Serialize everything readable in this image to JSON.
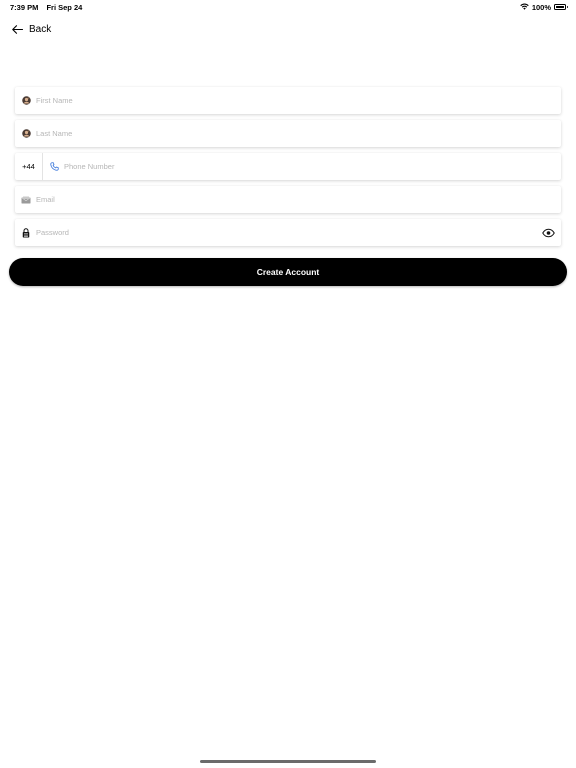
{
  "status_bar": {
    "time": "7:39 PM",
    "date": "Fri Sep 24",
    "battery": "100%",
    "battery_level": 1.0
  },
  "nav": {
    "back_label": "Back"
  },
  "form": {
    "first_name": {
      "placeholder": "First Name",
      "value": "",
      "icon": "user-avatar-icon"
    },
    "last_name": {
      "placeholder": "Last Name",
      "value": "",
      "icon": "user-avatar-icon"
    },
    "phone": {
      "country_code": "+44",
      "placeholder": "Phone Number",
      "value": "",
      "icon": "phone-icon"
    },
    "email": {
      "placeholder": "Email",
      "value": "",
      "icon": "envelope-icon"
    },
    "password": {
      "placeholder": "Password",
      "value": "",
      "icon": "lock-icon",
      "toggle_icon": "eye-icon"
    }
  },
  "actions": {
    "create_account_label": "Create Account"
  },
  "colors": {
    "button_bg": "#000000",
    "button_text": "#ffffff",
    "phone_icon": "#2f6fd8",
    "placeholder": "#b6b6b6"
  }
}
